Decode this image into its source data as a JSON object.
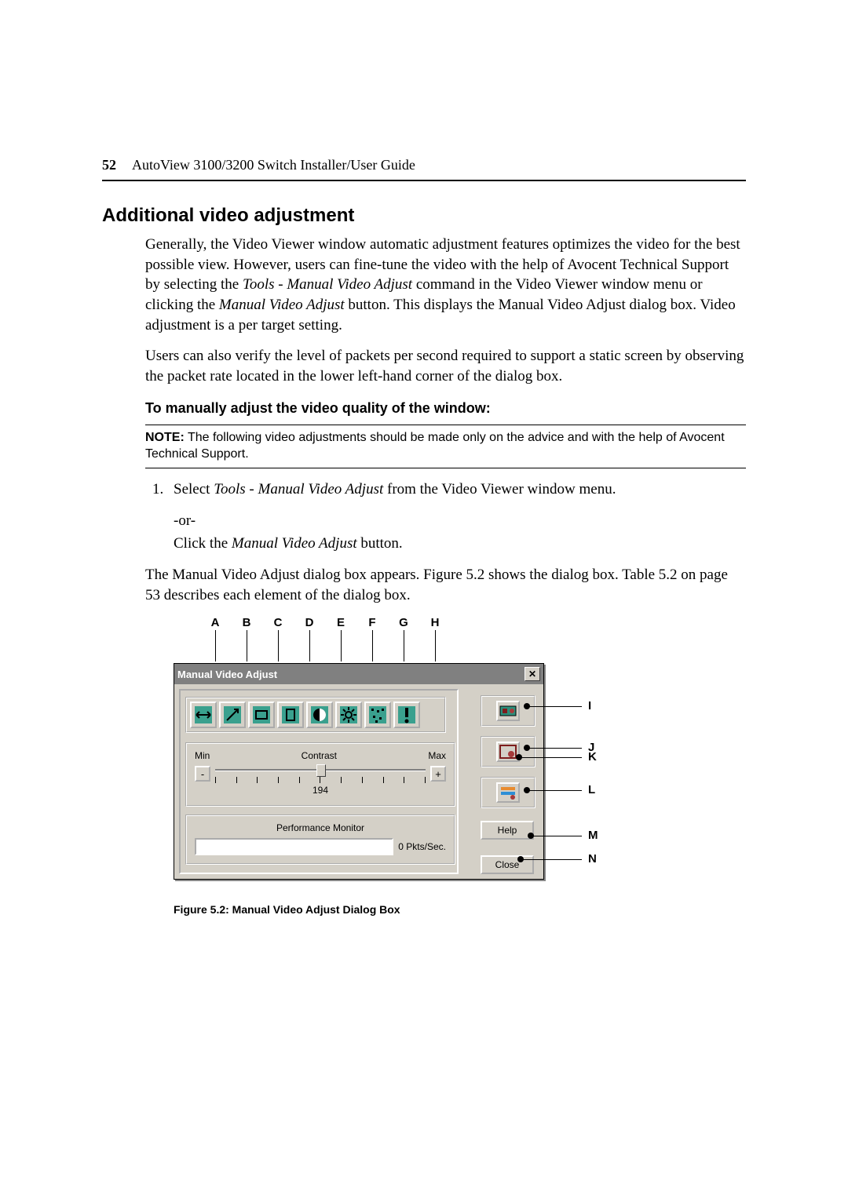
{
  "header": {
    "page_number": "52",
    "title": "AutoView 3100/3200 Switch Installer/User Guide"
  },
  "section_heading": "Additional video adjustment",
  "para1_a": "Generally, the Video Viewer window automatic adjustment features optimizes the video for the best possible view. However, users can fine-tune the video with the help of Avocent Technical Support by selecting the ",
  "para1_em1": "Tools - Manual Video Adjust",
  "para1_b": " command in the Video Viewer window menu or clicking the ",
  "para1_em2": "Manual Video Adjust",
  "para1_c": " button. This displays the Manual Video Adjust dialog box. Video adjustment is a per target setting.",
  "para2": "Users can also verify the level of packets per second required to support a static screen by observing the packet rate located in the lower left-hand corner of the dialog box.",
  "subheading": "To manually adjust the video quality of the window:",
  "note_bold": "NOTE:",
  "note_text": " The following video adjustments should be made only on the advice and with the help of Avocent Technical Support.",
  "step1_a": "Select ",
  "step1_em": "Tools - Manual Video Adjust",
  "step1_b": " from the Video Viewer window menu.",
  "step_or": "-or-",
  "step_click_a": "Click the ",
  "step_click_em": "Manual Video Adjust",
  "step_click_b": " button.",
  "step_result": "The Manual Video Adjust dialog box appears. Figure 5.2 shows the dialog box. Table 5.2 on page 53 describes each element of the dialog box.",
  "letters_top": [
    "A",
    "B",
    "C",
    "D",
    "E",
    "F",
    "G",
    "H"
  ],
  "dialog": {
    "title": "Manual Video Adjust",
    "toolbar_icons": [
      "image-capture-width-icon",
      "image-capture-fine-icon",
      "image-capture-horizontal-icon",
      "image-capture-vertical-icon",
      "contrast-icon",
      "brightness-icon",
      "noise-icon",
      "priority-icon"
    ],
    "slider": {
      "min_label": "Min",
      "center_label": "Contrast",
      "max_label": "Max",
      "minus": "-",
      "plus": "+",
      "value": "194",
      "tick_count": 11
    },
    "perf": {
      "label": "Performance Monitor",
      "value": "0  Pkts/Sec."
    },
    "right_icons": [
      "auto-video-adjust-icon",
      "refresh-icon",
      "video-bar-icon"
    ],
    "help_label": "Help",
    "close_label": "Close"
  },
  "letters_side": [
    "I",
    "J",
    "K",
    "L",
    "M",
    "N"
  ],
  "figcaption": "Figure 5.2: Manual Video Adjust Dialog Box"
}
